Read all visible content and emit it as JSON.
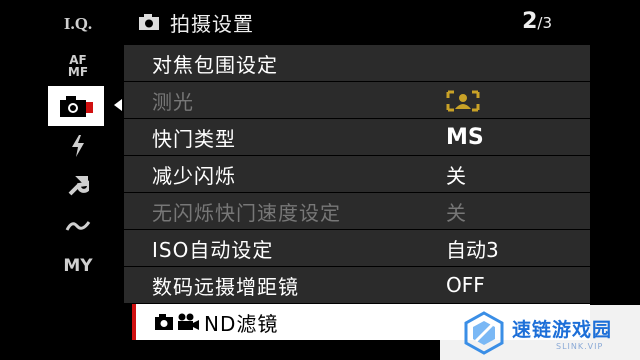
{
  "sidebar": {
    "items": [
      {
        "label": "I.Q."
      },
      {
        "label": "AF MF"
      },
      {
        "label": ""
      },
      {
        "label": ""
      },
      {
        "label": ""
      },
      {
        "label": ""
      },
      {
        "label": "MY"
      }
    ],
    "accent_color": "#d01010"
  },
  "header": {
    "title": "拍摄设置",
    "page_current": "2",
    "page_total": "/3"
  },
  "menu": {
    "rows": [
      {
        "label": "对焦包围设定",
        "value": ""
      },
      {
        "label": "测光",
        "value": ""
      },
      {
        "label": "快门类型",
        "value": "MS"
      },
      {
        "label": "减少闪烁",
        "value": "关"
      },
      {
        "label": "无闪烁快门速度设定",
        "value": "关"
      },
      {
        "label": "ISO自动设定",
        "value": "自动3"
      },
      {
        "label": "数码远摄增距镜",
        "value": "OFF"
      },
      {
        "label": "ND滤镜",
        "value": ""
      }
    ]
  },
  "watermark": {
    "main": "速链游戏园",
    "sub": "SLINK.VIP"
  }
}
